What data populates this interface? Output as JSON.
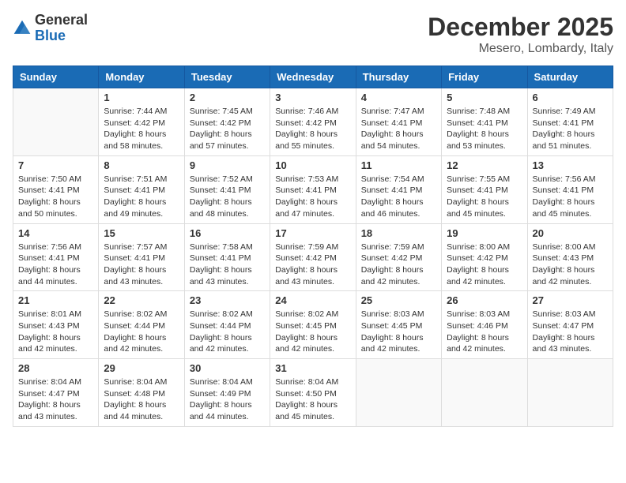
{
  "logo": {
    "general": "General",
    "blue": "Blue"
  },
  "title": "December 2025",
  "subtitle": "Mesero, Lombardy, Italy",
  "days_header": [
    "Sunday",
    "Monday",
    "Tuesday",
    "Wednesday",
    "Thursday",
    "Friday",
    "Saturday"
  ],
  "weeks": [
    [
      {
        "num": "",
        "sunrise": "",
        "sunset": "",
        "daylight": ""
      },
      {
        "num": "1",
        "sunrise": "Sunrise: 7:44 AM",
        "sunset": "Sunset: 4:42 PM",
        "daylight": "Daylight: 8 hours and 58 minutes."
      },
      {
        "num": "2",
        "sunrise": "Sunrise: 7:45 AM",
        "sunset": "Sunset: 4:42 PM",
        "daylight": "Daylight: 8 hours and 57 minutes."
      },
      {
        "num": "3",
        "sunrise": "Sunrise: 7:46 AM",
        "sunset": "Sunset: 4:42 PM",
        "daylight": "Daylight: 8 hours and 55 minutes."
      },
      {
        "num": "4",
        "sunrise": "Sunrise: 7:47 AM",
        "sunset": "Sunset: 4:41 PM",
        "daylight": "Daylight: 8 hours and 54 minutes."
      },
      {
        "num": "5",
        "sunrise": "Sunrise: 7:48 AM",
        "sunset": "Sunset: 4:41 PM",
        "daylight": "Daylight: 8 hours and 53 minutes."
      },
      {
        "num": "6",
        "sunrise": "Sunrise: 7:49 AM",
        "sunset": "Sunset: 4:41 PM",
        "daylight": "Daylight: 8 hours and 51 minutes."
      }
    ],
    [
      {
        "num": "7",
        "sunrise": "Sunrise: 7:50 AM",
        "sunset": "Sunset: 4:41 PM",
        "daylight": "Daylight: 8 hours and 50 minutes."
      },
      {
        "num": "8",
        "sunrise": "Sunrise: 7:51 AM",
        "sunset": "Sunset: 4:41 PM",
        "daylight": "Daylight: 8 hours and 49 minutes."
      },
      {
        "num": "9",
        "sunrise": "Sunrise: 7:52 AM",
        "sunset": "Sunset: 4:41 PM",
        "daylight": "Daylight: 8 hours and 48 minutes."
      },
      {
        "num": "10",
        "sunrise": "Sunrise: 7:53 AM",
        "sunset": "Sunset: 4:41 PM",
        "daylight": "Daylight: 8 hours and 47 minutes."
      },
      {
        "num": "11",
        "sunrise": "Sunrise: 7:54 AM",
        "sunset": "Sunset: 4:41 PM",
        "daylight": "Daylight: 8 hours and 46 minutes."
      },
      {
        "num": "12",
        "sunrise": "Sunrise: 7:55 AM",
        "sunset": "Sunset: 4:41 PM",
        "daylight": "Daylight: 8 hours and 45 minutes."
      },
      {
        "num": "13",
        "sunrise": "Sunrise: 7:56 AM",
        "sunset": "Sunset: 4:41 PM",
        "daylight": "Daylight: 8 hours and 45 minutes."
      }
    ],
    [
      {
        "num": "14",
        "sunrise": "Sunrise: 7:56 AM",
        "sunset": "Sunset: 4:41 PM",
        "daylight": "Daylight: 8 hours and 44 minutes."
      },
      {
        "num": "15",
        "sunrise": "Sunrise: 7:57 AM",
        "sunset": "Sunset: 4:41 PM",
        "daylight": "Daylight: 8 hours and 43 minutes."
      },
      {
        "num": "16",
        "sunrise": "Sunrise: 7:58 AM",
        "sunset": "Sunset: 4:41 PM",
        "daylight": "Daylight: 8 hours and 43 minutes."
      },
      {
        "num": "17",
        "sunrise": "Sunrise: 7:59 AM",
        "sunset": "Sunset: 4:42 PM",
        "daylight": "Daylight: 8 hours and 43 minutes."
      },
      {
        "num": "18",
        "sunrise": "Sunrise: 7:59 AM",
        "sunset": "Sunset: 4:42 PM",
        "daylight": "Daylight: 8 hours and 42 minutes."
      },
      {
        "num": "19",
        "sunrise": "Sunrise: 8:00 AM",
        "sunset": "Sunset: 4:42 PM",
        "daylight": "Daylight: 8 hours and 42 minutes."
      },
      {
        "num": "20",
        "sunrise": "Sunrise: 8:00 AM",
        "sunset": "Sunset: 4:43 PM",
        "daylight": "Daylight: 8 hours and 42 minutes."
      }
    ],
    [
      {
        "num": "21",
        "sunrise": "Sunrise: 8:01 AM",
        "sunset": "Sunset: 4:43 PM",
        "daylight": "Daylight: 8 hours and 42 minutes."
      },
      {
        "num": "22",
        "sunrise": "Sunrise: 8:02 AM",
        "sunset": "Sunset: 4:44 PM",
        "daylight": "Daylight: 8 hours and 42 minutes."
      },
      {
        "num": "23",
        "sunrise": "Sunrise: 8:02 AM",
        "sunset": "Sunset: 4:44 PM",
        "daylight": "Daylight: 8 hours and 42 minutes."
      },
      {
        "num": "24",
        "sunrise": "Sunrise: 8:02 AM",
        "sunset": "Sunset: 4:45 PM",
        "daylight": "Daylight: 8 hours and 42 minutes."
      },
      {
        "num": "25",
        "sunrise": "Sunrise: 8:03 AM",
        "sunset": "Sunset: 4:45 PM",
        "daylight": "Daylight: 8 hours and 42 minutes."
      },
      {
        "num": "26",
        "sunrise": "Sunrise: 8:03 AM",
        "sunset": "Sunset: 4:46 PM",
        "daylight": "Daylight: 8 hours and 42 minutes."
      },
      {
        "num": "27",
        "sunrise": "Sunrise: 8:03 AM",
        "sunset": "Sunset: 4:47 PM",
        "daylight": "Daylight: 8 hours and 43 minutes."
      }
    ],
    [
      {
        "num": "28",
        "sunrise": "Sunrise: 8:04 AM",
        "sunset": "Sunset: 4:47 PM",
        "daylight": "Daylight: 8 hours and 43 minutes."
      },
      {
        "num": "29",
        "sunrise": "Sunrise: 8:04 AM",
        "sunset": "Sunset: 4:48 PM",
        "daylight": "Daylight: 8 hours and 44 minutes."
      },
      {
        "num": "30",
        "sunrise": "Sunrise: 8:04 AM",
        "sunset": "Sunset: 4:49 PM",
        "daylight": "Daylight: 8 hours and 44 minutes."
      },
      {
        "num": "31",
        "sunrise": "Sunrise: 8:04 AM",
        "sunset": "Sunset: 4:50 PM",
        "daylight": "Daylight: 8 hours and 45 minutes."
      },
      {
        "num": "",
        "sunrise": "",
        "sunset": "",
        "daylight": ""
      },
      {
        "num": "",
        "sunrise": "",
        "sunset": "",
        "daylight": ""
      },
      {
        "num": "",
        "sunrise": "",
        "sunset": "",
        "daylight": ""
      }
    ]
  ]
}
